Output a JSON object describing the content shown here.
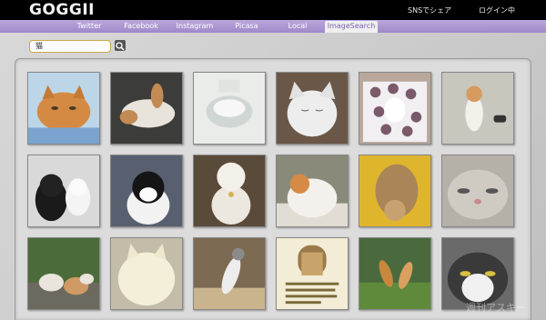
{
  "header": {
    "logo": "GOGGII",
    "share_label": "SNSでシェア",
    "login_label": "ログイン中"
  },
  "nav": {
    "tabs": [
      {
        "label": "Twitter"
      },
      {
        "label": "Facebook"
      },
      {
        "label": "Instagram"
      },
      {
        "label": "Picasa"
      },
      {
        "label": "Local"
      },
      {
        "label": "ImageSearch",
        "active": true
      }
    ]
  },
  "search": {
    "value": "猫",
    "button_icon": "search-icon"
  },
  "results": [
    {
      "name": "result-image-1",
      "desc": "orange tabby cat close-up"
    },
    {
      "name": "result-image-2",
      "desc": "cat lying on back"
    },
    {
      "name": "result-image-3",
      "desc": "cat silhouette white"
    },
    {
      "name": "result-image-4",
      "desc": "white cat eyes closed"
    },
    {
      "name": "result-image-5",
      "desc": "person holding cat"
    },
    {
      "name": "result-image-6",
      "desc": "standing cat"
    },
    {
      "name": "result-image-7",
      "desc": "black and white kittens"
    },
    {
      "name": "result-image-8",
      "desc": "black white cat"
    },
    {
      "name": "result-image-9",
      "desc": "white cat with bell"
    },
    {
      "name": "result-image-10",
      "desc": "orange white cat"
    },
    {
      "name": "result-image-11",
      "desc": "cat lying on yellow"
    },
    {
      "name": "result-image-12",
      "desc": "cat face close-up"
    },
    {
      "name": "result-image-13",
      "desc": "kittens on grass"
    },
    {
      "name": "result-image-14",
      "desc": "white cat blob"
    },
    {
      "name": "result-image-15",
      "desc": "jumping cat"
    },
    {
      "name": "result-image-16",
      "desc": "text poster with door"
    },
    {
      "name": "result-image-17",
      "desc": "cats fighting on grass"
    },
    {
      "name": "result-image-18",
      "desc": "cat face with stripes"
    }
  ],
  "watermark": "週刊アスキー",
  "colors": {
    "nav_purple": "#a891cf",
    "active_tab_text": "#7b63ad",
    "search_border": "#c9a94a"
  }
}
